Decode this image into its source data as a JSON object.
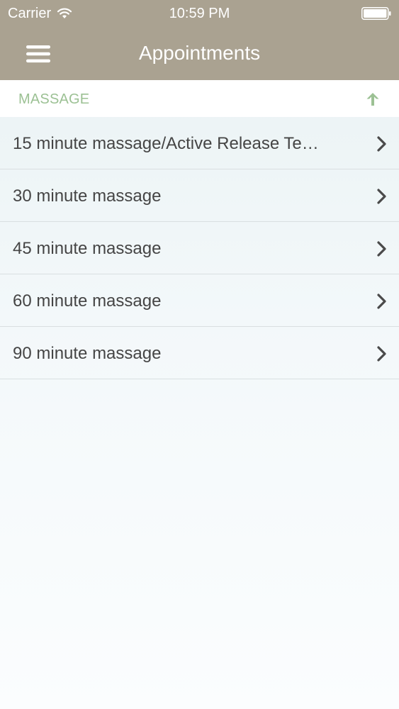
{
  "status_bar": {
    "carrier": "Carrier",
    "time": "10:59 PM",
    "wifi_icon": "wifi-icon",
    "battery_icon": "battery-full-icon"
  },
  "nav": {
    "title": "Appointments",
    "menu_icon": "hamburger-menu-icon"
  },
  "section": {
    "title": "MASSAGE",
    "collapse_icon": "arrow-up-icon",
    "accent_color": "#9cc194"
  },
  "items": [
    {
      "label": "15 minute massage/Active Release Te…",
      "icon": "chevron-right-icon"
    },
    {
      "label": "30 minute massage",
      "icon": "chevron-right-icon"
    },
    {
      "label": "45 minute massage",
      "icon": "chevron-right-icon"
    },
    {
      "label": "60 minute massage",
      "icon": "chevron-right-icon"
    },
    {
      "label": "90 minute massage",
      "icon": "chevron-right-icon"
    }
  ],
  "colors": {
    "top_bar": "#aaa291",
    "text": "#454545",
    "chevron": "#4a4a4a"
  }
}
